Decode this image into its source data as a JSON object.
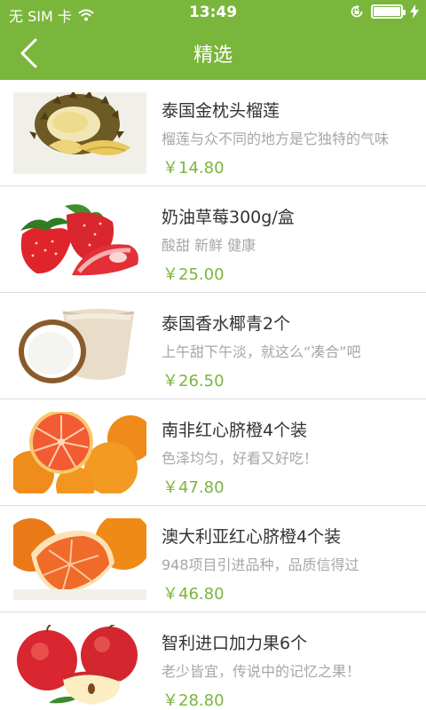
{
  "status_bar": {
    "carrier": "无 SIM 卡",
    "time": "13:49",
    "battery_level": 1.0
  },
  "header": {
    "title": "精选"
  },
  "colors": {
    "accent": "#7ab63c",
    "divider": "#dddddd",
    "title_text": "#333333",
    "desc_text": "#a7a7a7"
  },
  "products": [
    {
      "name": "泰国金枕头榴莲",
      "desc": "榴莲与众不同的地方是它独特的气味",
      "price": "￥14.80",
      "image": "durian"
    },
    {
      "name": "奶油草莓300g/盒",
      "desc": "酸甜 新鲜 健康",
      "price": "￥25.00",
      "image": "strawberry"
    },
    {
      "name": "泰国香水椰青2个",
      "desc": "上午甜下午淡，就这么“凑合”吧",
      "price": "￥26.50",
      "image": "coconut"
    },
    {
      "name": "南非红心脐橙4个装",
      "desc": "色泽均匀，好看又好吃！",
      "price": "￥47.80",
      "image": "navel-orange"
    },
    {
      "name": "澳大利亚红心脐橙4个装",
      "desc": "948项目引进品种，品质信得过",
      "price": "￥46.80",
      "image": "red-orange"
    },
    {
      "name": "智利进口加力果6个",
      "desc": "老少皆宜，传说中的记忆之果！",
      "price": "￥28.80",
      "image": "apple"
    }
  ]
}
